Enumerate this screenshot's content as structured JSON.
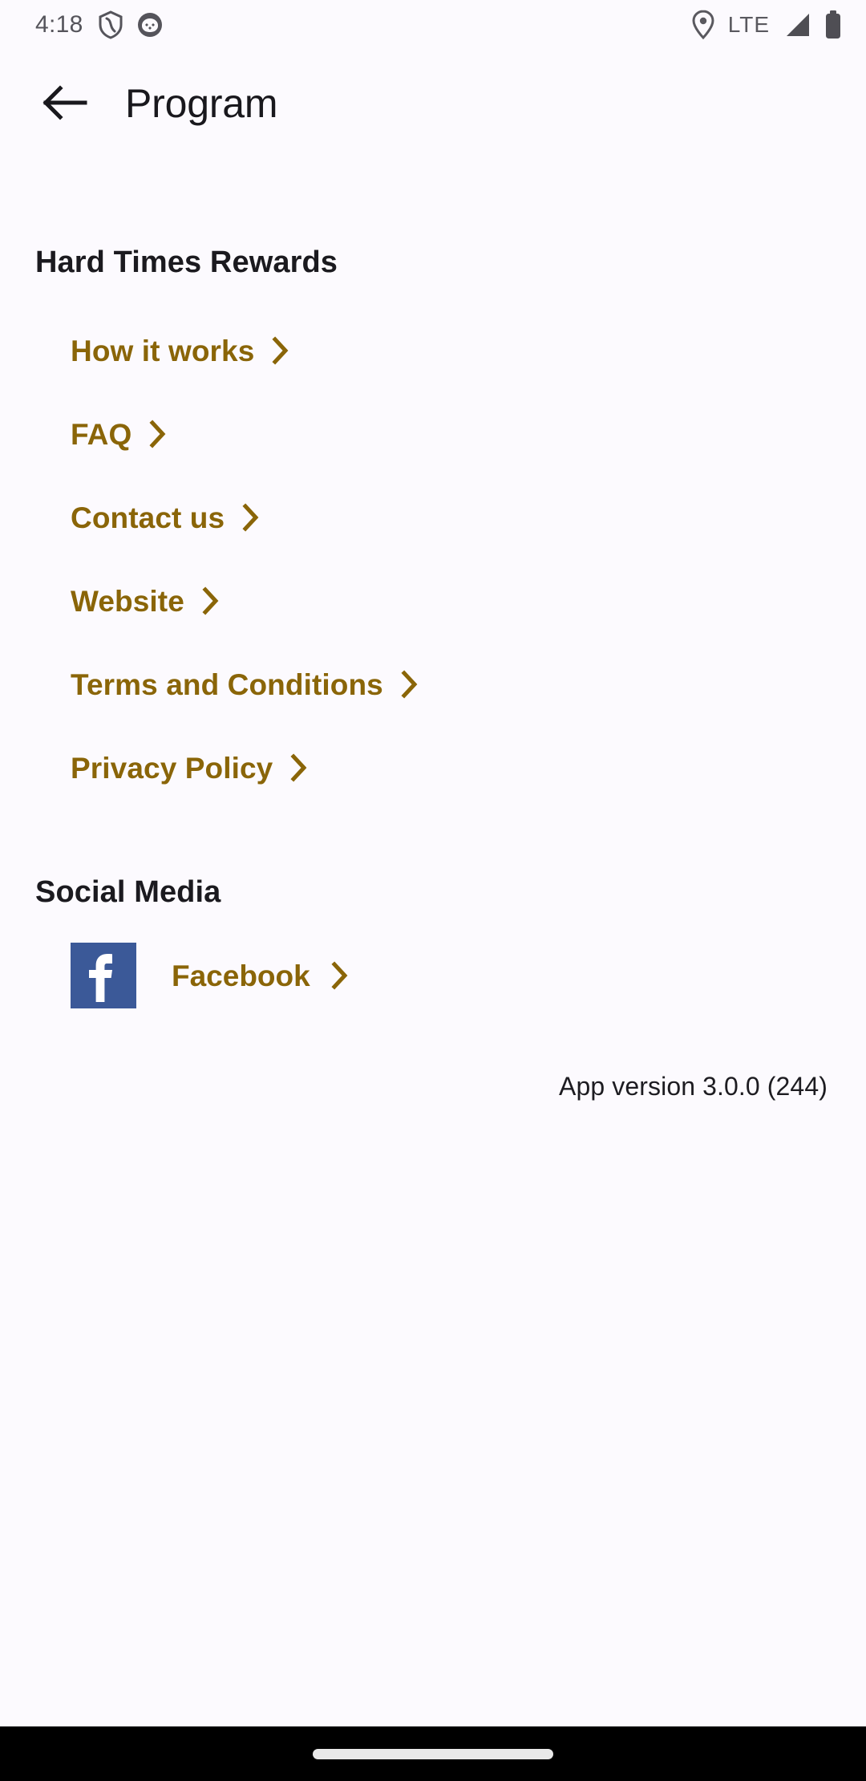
{
  "status_bar": {
    "time": "4:18",
    "network_label": "LTE",
    "icons": [
      "shield-icon",
      "app-notification-icon",
      "location-pin-icon",
      "signal-icon",
      "battery-icon"
    ]
  },
  "header": {
    "back_icon": "arrow-left-icon",
    "title": "Program"
  },
  "sections": [
    {
      "title": "Hard Times Rewards",
      "items": [
        {
          "label": "How it works",
          "chevron": "chevron-right-icon"
        },
        {
          "label": "FAQ",
          "chevron": "chevron-right-icon"
        },
        {
          "label": "Contact us",
          "chevron": "chevron-right-icon"
        },
        {
          "label": "Website",
          "chevron": "chevron-right-icon"
        },
        {
          "label": "Terms and Conditions",
          "chevron": "chevron-right-icon"
        },
        {
          "label": "Privacy Policy",
          "chevron": "chevron-right-icon"
        }
      ]
    },
    {
      "title": "Social Media",
      "items": [
        {
          "label": "Facebook",
          "icon": "facebook-icon",
          "glyph": "f",
          "chevron": "chevron-right-icon"
        }
      ]
    }
  ],
  "footer": {
    "app_version": "App version 3.0.0 (244)"
  },
  "colors": {
    "background": "#FCFAFE",
    "link": "#8A6508",
    "heading": "#1B1A1F",
    "facebook_blue": "#3B5998",
    "nav_bar": "#000000"
  }
}
